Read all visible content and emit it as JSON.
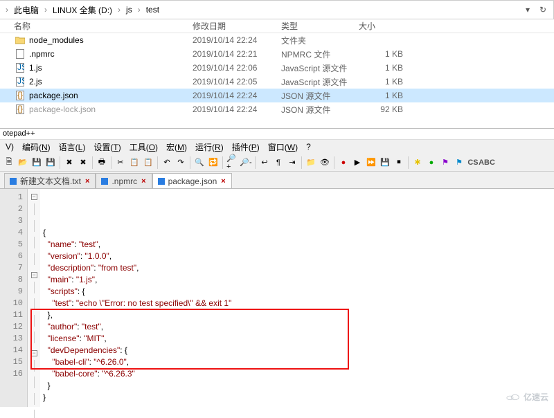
{
  "breadcrumb": {
    "items": [
      "此电脑",
      "LINUX 全集 (D:)",
      "js",
      "test"
    ]
  },
  "columns": {
    "name": "名称",
    "date": "修改日期",
    "type": "类型",
    "size": "大小"
  },
  "files": [
    {
      "name": "node_modules",
      "date": "2019/10/14 22:24",
      "type": "文件夹",
      "size": "",
      "kind": "folder",
      "selected": false
    },
    {
      "name": ".npmrc",
      "date": "2019/10/14 22:21",
      "type": "NPMRC 文件",
      "size": "1 KB",
      "kind": "file",
      "selected": false
    },
    {
      "name": "1.js",
      "date": "2019/10/14 22:06",
      "type": "JavaScript 源文件",
      "size": "1 KB",
      "kind": "jsfile",
      "selected": false
    },
    {
      "name": "2.js",
      "date": "2019/10/14 22:05",
      "type": "JavaScript 源文件",
      "size": "1 KB",
      "kind": "jsfile",
      "selected": false
    },
    {
      "name": "package.json",
      "date": "2019/10/14 22:24",
      "type": "JSON 源文件",
      "size": "1 KB",
      "kind": "json",
      "selected": true
    },
    {
      "name": "package-lock.json",
      "date": "2019/10/14 22:24",
      "type": "JSON 源文件",
      "size": "92 KB",
      "kind": "json",
      "selected": false,
      "clipped": true
    }
  ],
  "npp_title": "otepad++",
  "menu": [
    "V)",
    "编码(N)",
    "语言(L)",
    "设置(T)",
    "工具(O)",
    "宏(M)",
    "运行(R)",
    "插件(P)",
    "窗口(W)",
    "?"
  ],
  "tabs": [
    {
      "label": "新建文本文档.txt",
      "active": false
    },
    {
      "label": ".npmrc",
      "active": false
    },
    {
      "label": "package.json",
      "active": true
    }
  ],
  "code": {
    "lines": [
      "{",
      "  \"name\": \"test\",",
      "  \"version\": \"1.0.0\",",
      "  \"description\": \"from test\",",
      "  \"main\": \"1.js\",",
      "  \"scripts\": {",
      "    \"test\": \"echo \\\"Error: no test specified\\\" && exit 1\"",
      "  },",
      "  \"author\": \"test\",",
      "  \"license\": \"MIT\",",
      "  \"devDependencies\": {",
      "    \"babel-cli\": \"^6.26.0\",",
      "    \"babel-core\": \"^6.26.3\"",
      "  }",
      "}",
      ""
    ]
  },
  "watermark": "亿速云"
}
